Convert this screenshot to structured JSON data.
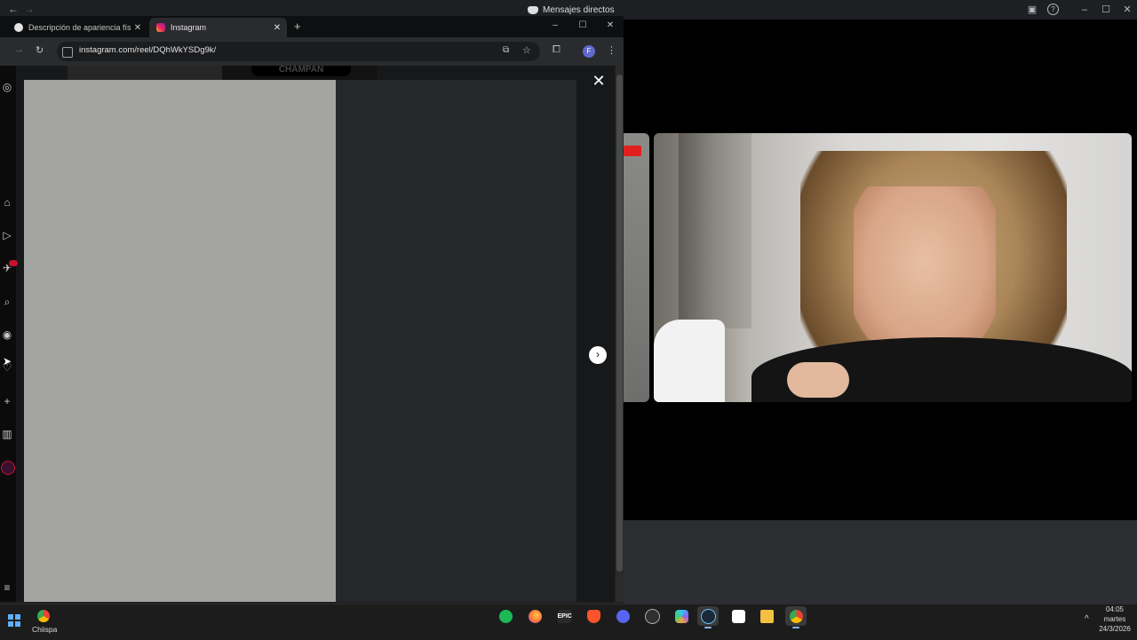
{
  "discord": {
    "title": "Mensajes directos",
    "icon": "discord-icon",
    "controls": {
      "minimize": "–",
      "maximize": "☐",
      "close": "✕",
      "help": "?",
      "inbox": "▣"
    },
    "nav": {
      "back": "←",
      "forward": "→"
    }
  },
  "browser": {
    "tabs": [
      {
        "title": "Descripción de apariencia física",
        "close": "✕",
        "icon": "chatgpt-icon"
      },
      {
        "title": "Instagram",
        "close": "✕",
        "icon": "instagram-icon"
      }
    ],
    "new_tab": "+",
    "window_controls": {
      "minimize": "–",
      "maximize": "☐",
      "close": "✕"
    },
    "nav": {
      "forward": "→",
      "reload": "↻"
    },
    "url": "instagram.com/reel/DQhWkYSDg9k/",
    "profile_initial": "F",
    "icons": {
      "cast": "⧉",
      "star": "☆",
      "extensions": "⧠",
      "menu": "⋮"
    }
  },
  "instagram": {
    "close": "✕",
    "next": "›",
    "bg_banner": "CHAMPAN",
    "sidebar_icons": [
      "instagram-icon",
      "home-icon",
      "reels-icon",
      "messages-icon",
      "search-icon",
      "explore-icon",
      "notifications-icon",
      "create-icon",
      "dashboard-icon",
      "profile-avatar",
      "more-icon"
    ],
    "sidebar_glyphs": {
      "logo": "◎",
      "home": "⌂",
      "reels": "▷",
      "messages": "✈",
      "search": "⌕",
      "explore": "◉",
      "notifications": "♡",
      "create": "+",
      "dashboard": "▥",
      "more": "≡"
    }
  },
  "taskbar": {
    "pinned_app_label": "Chiispa",
    "apps": [
      "spotify",
      "firefox",
      "epic-games",
      "brave",
      "discord",
      "obs",
      "copilot",
      "steam",
      "capcut",
      "file-explorer",
      "chrome"
    ],
    "epic_label": "EPIC",
    "clock": {
      "time": "04:05",
      "day": "martes",
      "date": "24/3/2026"
    },
    "tray_up": "^"
  }
}
